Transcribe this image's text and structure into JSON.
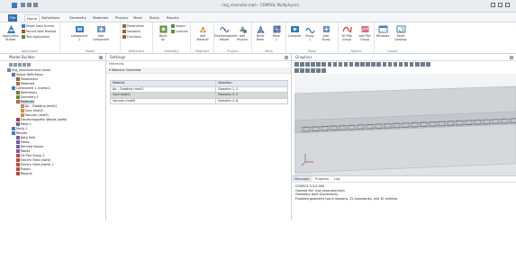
{
  "window": {
    "title": "ring_resonator.mph - COMSOL Multiphysics",
    "accent": "#3a6fb0"
  },
  "ribbon_tabs": [
    "File",
    "Home",
    "Definitions",
    "Geometry",
    "Materials",
    "Physics",
    "Mesh",
    "Study",
    "Results"
  ],
  "ribbon": {
    "groups": [
      "Application",
      "Model",
      "Definitions",
      "Geometry",
      "Materials",
      "Physics",
      "Mesh",
      "Study",
      "Results",
      "Layout"
    ],
    "application": {
      "app_builder": "Application\nBuilder",
      "model_data_access": "Model Data Access",
      "model_method": "Record New Method",
      "test_application": "Test Application"
    },
    "model": {
      "component": "Component\n1",
      "add_component": "Add\nComponent"
    },
    "definitions": {
      "parameters": "Parameters",
      "variables": "Variables",
      "functions": "Functions"
    },
    "geometry": {
      "build_all": "Build\nAll",
      "import": "Import",
      "livelink": "LiveLink"
    },
    "materials": {
      "add_material": "Add\nMaterial"
    },
    "physics": {
      "electromagnetic_waves": "Electromagnetic\nWaves",
      "add_physics": "Add\nPhysics"
    },
    "mesh": {
      "build_mesh": "Build\nMesh",
      "mesh1": "Mesh\n1"
    },
    "study": {
      "compute": "Compute",
      "study1": "Study\n1",
      "add_study": "Add\nStudy"
    },
    "results": {
      "plot_group": "2D Plot\nGroup",
      "add_plot_group": "Add Plot\nGroup"
    },
    "layout": {
      "windows": "Windows",
      "reset_desktop": "Reset\nDesktop"
    }
  },
  "model_builder": {
    "title": "Model Builder",
    "tree": [
      {
        "label": "ring_resonator.mph (root)",
        "depth": 0,
        "icon": "root-icon",
        "color": "#7a8896"
      },
      {
        "label": "Global Definitions",
        "depth": 1,
        "icon": "globe-icon",
        "color": "#3f7ec9"
      },
      {
        "label": "Parameters",
        "depth": 2,
        "icon": "parameters-icon",
        "color": "#8a6b3a"
      },
      {
        "label": "Materials",
        "depth": 2,
        "icon": "materials-icon",
        "color": "#c06a2c"
      },
      {
        "label": "Component 1 (comp1)",
        "depth": 1,
        "icon": "component-icon",
        "color": "#3f7ec9"
      },
      {
        "label": "Definitions",
        "depth": 2,
        "icon": "definitions-icon",
        "color": "#8a6b3a"
      },
      {
        "label": "Geometry 1",
        "depth": 2,
        "icon": "geometry-icon",
        "color": "#5a8f3a"
      },
      {
        "label": "Materials",
        "depth": 2,
        "icon": "materials-icon",
        "color": "#c06a2c",
        "selected": true
      },
      {
        "label": "Air - Cladding (mat1)",
        "depth": 3,
        "icon": "material-icon",
        "color": "#d8903f"
      },
      {
        "label": "Core (mat2)",
        "depth": 3,
        "icon": "material-icon",
        "color": "#d8903f"
      },
      {
        "label": "Vacuum (mat3)",
        "depth": 3,
        "icon": "material-icon",
        "color": "#d8903f"
      },
      {
        "label": "Electromagnetic Waves (ewfd)",
        "depth": 2,
        "icon": "physics-icon",
        "color": "#b33b3b"
      },
      {
        "label": "Mesh 1",
        "depth": 2,
        "icon": "mesh-icon",
        "color": "#4a6fa8"
      },
      {
        "label": "Study 1",
        "depth": 1,
        "icon": "study-icon",
        "color": "#3f7ec9"
      },
      {
        "label": "Results",
        "depth": 1,
        "icon": "results-icon",
        "color": "#3f7ec9"
      },
      {
        "label": "Data Sets",
        "depth": 2,
        "icon": "datasets-icon",
        "color": "#7c5aa6"
      },
      {
        "label": "Views",
        "depth": 2,
        "icon": "views-icon",
        "color": "#7c5aa6"
      },
      {
        "label": "Derived Values",
        "depth": 2,
        "icon": "derived-values-icon",
        "color": "#7c5aa6"
      },
      {
        "label": "Tables",
        "depth": 2,
        "icon": "tables-icon",
        "color": "#7c5aa6"
      },
      {
        "label": "1D Plot Group 3",
        "depth": 2,
        "icon": "plot-icon",
        "color": "#c0463f"
      },
      {
        "label": "Electric Field (ewfd)",
        "depth": 2,
        "icon": "plot-icon",
        "color": "#c0463f"
      },
      {
        "label": "Electric Field (ewfd) 1",
        "depth": 2,
        "icon": "plot-icon",
        "color": "#c0463f"
      },
      {
        "label": "Export",
        "depth": 2,
        "icon": "export-icon",
        "color": "#c0463f"
      },
      {
        "label": "Reports",
        "depth": 2,
        "icon": "reports-icon",
        "color": "#c0463f"
      }
    ]
  },
  "settings": {
    "title": "Settings",
    "subtitle": "Materials",
    "section": "Material Overview",
    "columns": [
      "Material",
      "Selection"
    ],
    "rows": [
      [
        "Air - Cladding (mat1)",
        "Domains 1, 2"
      ],
      [
        "Core (mat2)",
        "Domains 3, 5"
      ],
      [
        "Vacuum (mat3)",
        "Domains 4, 6"
      ]
    ],
    "selected_row": 1
  },
  "graphics": {
    "title": "Graphics"
  },
  "messages": {
    "tabs": [
      "Messages",
      "Progress",
      "Log"
    ],
    "active_tab": 0,
    "lines": [
      "COMSOL 5.3.0.260",
      "Opened file: ring_resonator.mph",
      "Geometry built successfully.",
      "Finalized geometry has 6 domains, 32 boundaries, and 30 vertices."
    ]
  }
}
